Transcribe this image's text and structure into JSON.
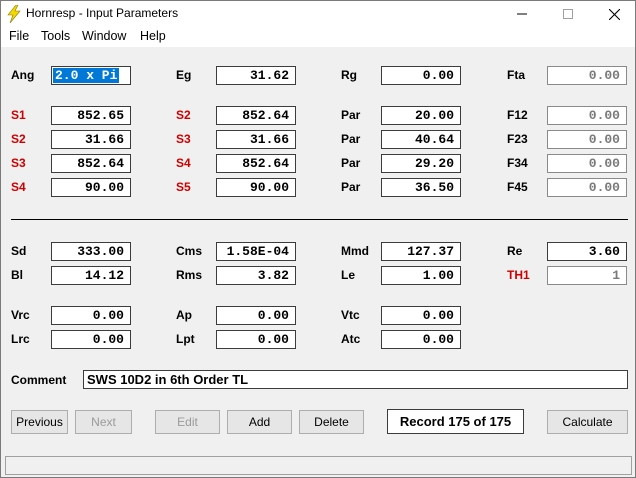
{
  "window": {
    "title": "Hornresp - Input Parameters",
    "minimize_glyph": "—",
    "maximize_glyph": "☐",
    "close_glyph": "✕"
  },
  "menu": [
    "File",
    "Tools",
    "Window",
    "Help"
  ],
  "top_row": [
    {
      "label": "Ang",
      "value": "2.0 x Pi"
    },
    {
      "label": "Eg",
      "value": "31.62"
    },
    {
      "label": "Rg",
      "value": "0.00"
    },
    {
      "label": "Fta",
      "value": "0.00"
    }
  ],
  "segments": [
    [
      {
        "label": "S1",
        "value": "852.65"
      },
      {
        "label": "S2",
        "value": "852.64"
      },
      {
        "label": "Par",
        "value": "20.00"
      },
      {
        "label": "F12",
        "value": "0.00"
      }
    ],
    [
      {
        "label": "S2",
        "value": "31.66"
      },
      {
        "label": "S3",
        "value": "31.66"
      },
      {
        "label": "Par",
        "value": "40.64"
      },
      {
        "label": "F23",
        "value": "0.00"
      }
    ],
    [
      {
        "label": "S3",
        "value": "852.64"
      },
      {
        "label": "S4",
        "value": "852.64"
      },
      {
        "label": "Par",
        "value": "29.20"
      },
      {
        "label": "F34",
        "value": "0.00"
      }
    ],
    [
      {
        "label": "S4",
        "value": "90.00"
      },
      {
        "label": "S5",
        "value": "90.00"
      },
      {
        "label": "Par",
        "value": "36.50"
      },
      {
        "label": "F45",
        "value": "0.00"
      }
    ]
  ],
  "driver_row1": [
    {
      "label": "Sd",
      "value": "333.00"
    },
    {
      "label": "Cms",
      "value": "1.58E-04"
    },
    {
      "label": "Mmd",
      "value": "127.37"
    },
    {
      "label": "Re",
      "value": "3.60"
    }
  ],
  "driver_row2": [
    {
      "label": "Bl",
      "value": "14.12"
    },
    {
      "label": "Rms",
      "value": "3.82"
    },
    {
      "label": "Le",
      "value": "1.00"
    },
    {
      "label": "TH1",
      "value": "1"
    }
  ],
  "chamber_row1": [
    {
      "label": "Vrc",
      "value": "0.00"
    },
    {
      "label": "Ap",
      "value": "0.00"
    },
    {
      "label": "Vtc",
      "value": "0.00"
    }
  ],
  "chamber_row2": [
    {
      "label": "Lrc",
      "value": "0.00"
    },
    {
      "label": "Lpt",
      "value": "0.00"
    },
    {
      "label": "Atc",
      "value": "0.00"
    }
  ],
  "comment": {
    "label": "Comment",
    "value": "SWS 10D2 in 6th Order TL"
  },
  "buttons": {
    "previous": "Previous",
    "next": "Next",
    "edit": "Edit",
    "add": "Add",
    "delete": "Delete",
    "calculate": "Calculate"
  },
  "record": "Record 175 of 175",
  "colors": {
    "red_label": "#cc0000",
    "selection": "#0078d7",
    "icon_yellow": "#f5d800"
  }
}
